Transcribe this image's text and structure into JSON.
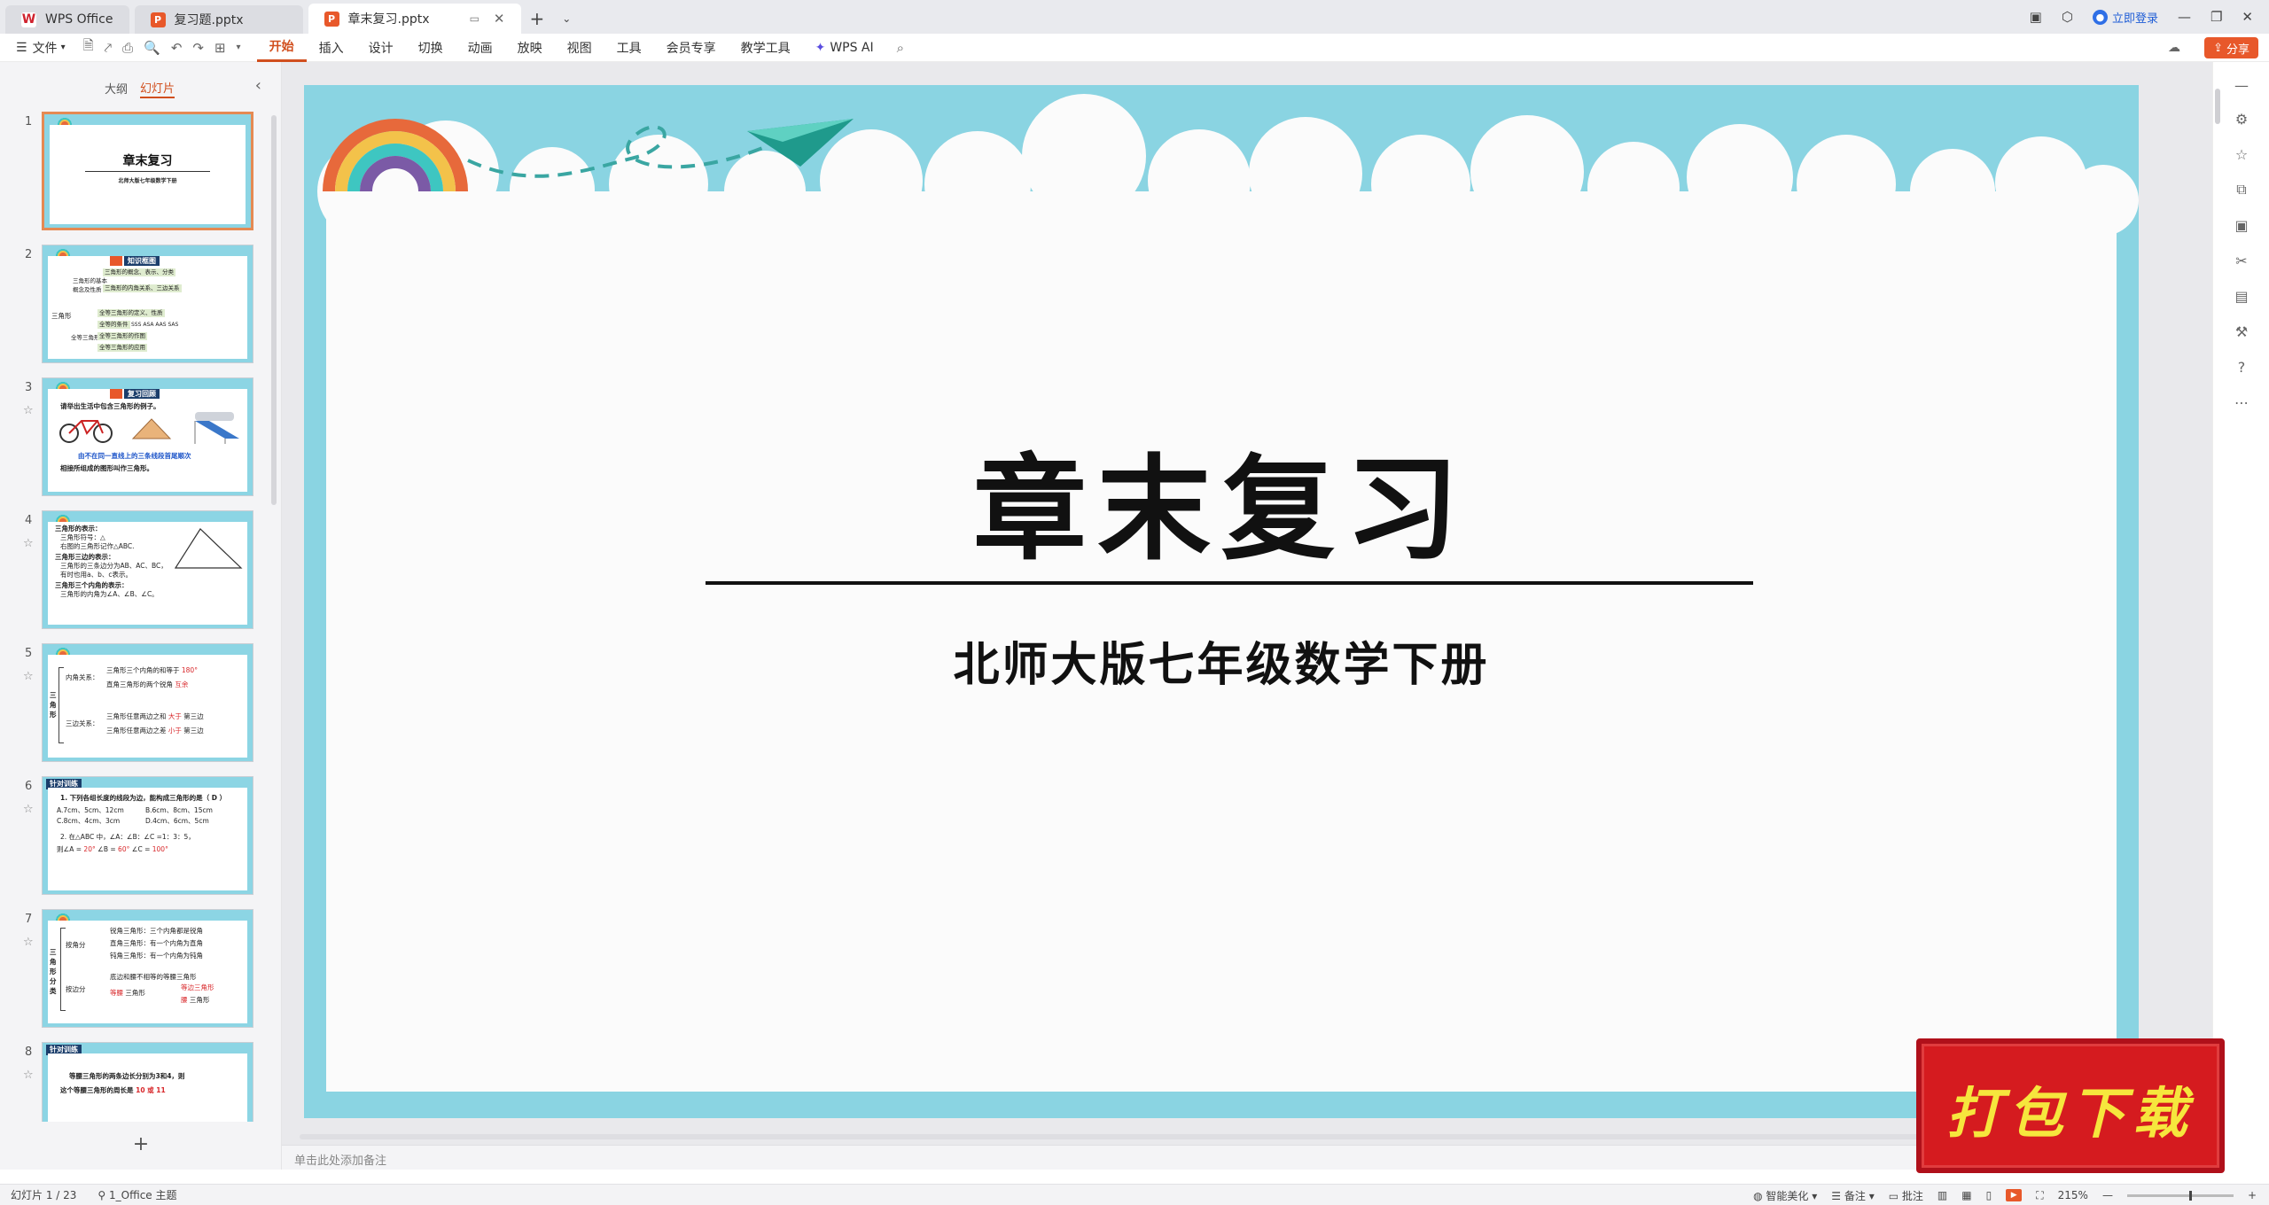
{
  "titlebar": {
    "tabs": [
      {
        "label": "WPS Office",
        "icon": "wps-logo-icon"
      },
      {
        "label": "复习题.pptx",
        "icon": "presentation-file-icon"
      },
      {
        "label": "章末复习.pptx",
        "icon": "presentation-file-icon"
      }
    ],
    "login_label": "立即登录"
  },
  "ribbon": {
    "file_label": "文件",
    "tabs": [
      "开始",
      "插入",
      "设计",
      "切换",
      "动画",
      "放映",
      "视图",
      "工具",
      "会员专享",
      "教学工具",
      "WPS AI"
    ],
    "active_tab": "开始",
    "share_label": "分享"
  },
  "leftpane": {
    "tabs": [
      "大纲",
      "幻灯片"
    ],
    "active_tab": "幻灯片",
    "thumbnails": [
      {
        "num": "1",
        "title": "章末复习",
        "subtitle": "北师大版七年级数学下册"
      },
      {
        "num": "2",
        "header": "知识框图",
        "root": "三角形",
        "branch1": "三角形的基本概念及性质",
        "branch2": "全等三角形",
        "items1": [
          "三角形的概念、表示、分类",
          "三角形的内角关系、三边关系"
        ],
        "items2": [
          "全等三角形的定义、性质",
          "全等的条件",
          "全等三角形的作图",
          "全等三角形的应用"
        ],
        "conds": "SSS  ASA  AAS  SAS"
      },
      {
        "num": "3",
        "header": "复习回顾",
        "line1": "请举出生活中包含三角形的例子。",
        "line2": "由不在同一直线上的三条线段首尾顺次",
        "line3": "相接所组成的图形叫作三角形。"
      },
      {
        "num": "4",
        "lines": [
          "三角形的表示：",
          "三角形符号：△",
          "右图的三角形记作△ABC.",
          "三角形三边的表示：",
          "三角形的三条边分为AB、AC、BC，",
          "有时也用a、b、c表示。",
          "三角形三个内角的表示：",
          "三角形的内角为∠A、∠B、∠C。"
        ]
      },
      {
        "num": "5",
        "root": "三角形",
        "g1": "内角关系：",
        "g2": "三边关系：",
        "l1": "三角形三个内角的和等于",
        "v1": "180°",
        "l2": "直角三角形的两个锐角",
        "v2": "互余",
        "l3": "三角形任意两边之和",
        "v3": "大于",
        "l3b": "第三边",
        "l4": "三角形任意两边之差",
        "v4": "小于",
        "l4b": "第三边"
      },
      {
        "num": "6",
        "header": "针对训练",
        "q1": "1. 下列各组长度的线段为边，能构成三角形的是（ D ）",
        "opts": [
          "A.7cm、5cm、12cm",
          "B.6cm、8cm、15cm",
          "C.8cm、4cm、3cm",
          "D.4cm、6cm、5cm"
        ],
        "q2": "2. 在△ABC 中，∠A：∠B：∠C =1：3：5，",
        "q2b": "则∠A =",
        "a1": "20°",
        "q2c": "∠B =",
        "a2": "60°",
        "q2d": "∠C =",
        "a3": "100°"
      },
      {
        "num": "7",
        "root": "三角形分类",
        "g1": "按角分",
        "g2": "按边分",
        "rows": [
          "锐角三角形：三个内角都是锐角",
          "直角三角形：有一个内角为直角",
          "钝角三角形：有一个内角为钝角"
        ],
        "s1": "底边和腰不相等的等腰三角形",
        "s2": "等腰",
        "s3": "三角形",
        "s4": "等边三角形",
        "s5": "腰",
        "s6": "三角形"
      },
      {
        "num": "8",
        "header": "针对训练",
        "q": "等腰三角形的两条边长分别为3和4，则",
        "q2": "这个等腰三角形的周长是",
        "ans": "10 或 11"
      }
    ],
    "add_slide_symbol": "+"
  },
  "slide": {
    "title": "章末复习",
    "subtitle": "北师大版七年级数学下册",
    "colors": {
      "sky": "#8ad4e2",
      "paper": "#fbfbfb",
      "accent": "#e8582a"
    }
  },
  "notes_placeholder": "单击此处添加备注",
  "statusbar": {
    "slide_counter": "幻灯片 1 / 23",
    "theme": "1_Office 主题",
    "beautify": "智能美化",
    "notes": "备注",
    "comments": "批注",
    "zoom": "215%"
  },
  "badge": {
    "text": "打包下载",
    "color": "#d51b1f",
    "text_color": "#f6e63d"
  }
}
